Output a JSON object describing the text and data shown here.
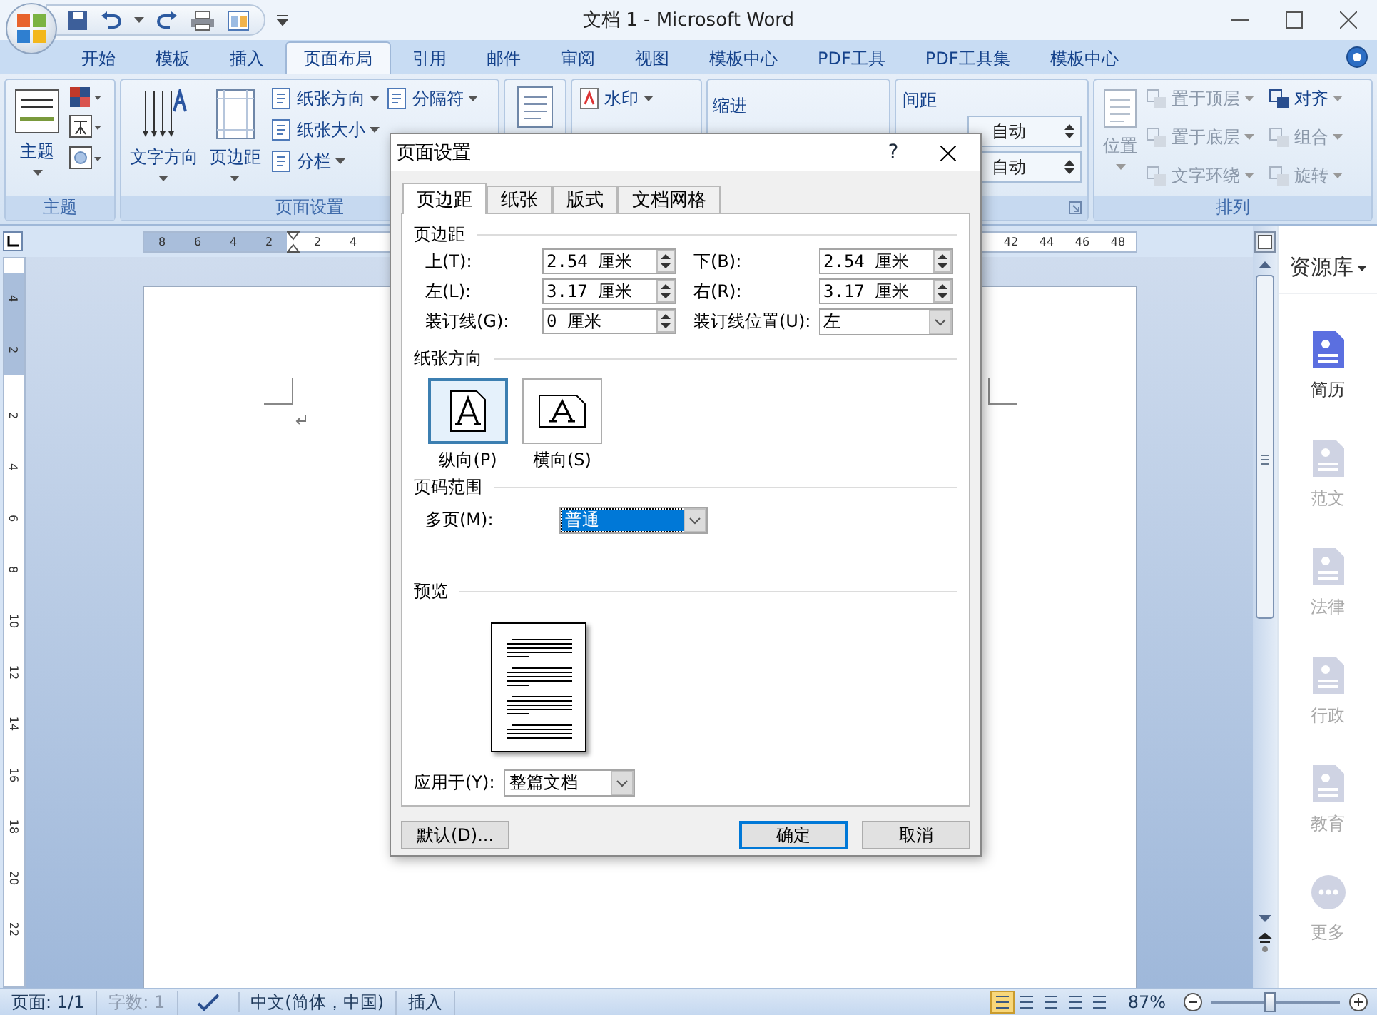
{
  "window": {
    "title": "文档 1 - Microsoft Word"
  },
  "tabs": [
    {
      "label": "开始",
      "selected": false
    },
    {
      "label": "模板",
      "selected": false
    },
    {
      "label": "插入",
      "selected": false
    },
    {
      "label": "页面布局",
      "selected": true
    },
    {
      "label": "引用",
      "selected": false
    },
    {
      "label": "邮件",
      "selected": false
    },
    {
      "label": "审阅",
      "selected": false
    },
    {
      "label": "视图",
      "selected": false
    },
    {
      "label": "模板中心",
      "selected": false
    },
    {
      "label": "PDF工具",
      "selected": false
    },
    {
      "label": "PDF工具集",
      "selected": false
    },
    {
      "label": "模板中心",
      "selected": false
    }
  ],
  "ribbon": {
    "theme": {
      "label": "主题",
      "button": "主题"
    },
    "page_setup": {
      "label": "页面设置",
      "large_buttons": [
        "文字方向",
        "页边距"
      ],
      "small_buttons": [
        "纸张方向",
        "纸张大小",
        "分栏"
      ],
      "breaks": "分隔符"
    },
    "background": {
      "watermark": "水印"
    },
    "paragraph": {
      "indent": "缩进",
      "spacing": "间距",
      "spacing_values": [
        "自动",
        "自动"
      ]
    },
    "arrange": {
      "label": "排列",
      "position": {
        "label": "位置",
        "disabled": true
      },
      "items": [
        {
          "label": "置于顶层",
          "disabled": true
        },
        {
          "label": "对齐",
          "disabled": false
        },
        {
          "label": "置于底层",
          "disabled": true
        },
        {
          "label": "组合",
          "disabled": true
        },
        {
          "label": "文字环绕",
          "disabled": true
        },
        {
          "label": "旋转",
          "disabled": true
        }
      ]
    }
  },
  "ruler": {
    "left_numbers": [
      "8",
      "6",
      "4",
      "2"
    ],
    "right_numbers": [
      "2",
      "4"
    ],
    "far_numbers": [
      "42",
      "44",
      "46",
      "48"
    ]
  },
  "vertical_ruler": {
    "top_numbers": [
      "4",
      "2"
    ],
    "numbers": [
      "2",
      "4",
      "6",
      "8",
      "10",
      "12",
      "14",
      "16",
      "18",
      "20",
      "22"
    ]
  },
  "dialog": {
    "title": "页面设置",
    "help": "?",
    "tabs": [
      {
        "label": "页边距",
        "selected": true
      },
      {
        "label": "纸张",
        "selected": false
      },
      {
        "label": "版式",
        "selected": false
      },
      {
        "label": "文档网格",
        "selected": false
      }
    ],
    "margins": {
      "title": "页边距",
      "fields": [
        {
          "label": "上(T):",
          "value": "2.54 厘米",
          "kind": "spin"
        },
        {
          "label": "下(B):",
          "value": "2.54 厘米",
          "kind": "spin"
        },
        {
          "label": "左(L):",
          "value": "3.17 厘米",
          "kind": "spin"
        },
        {
          "label": "右(R):",
          "value": "3.17 厘米",
          "kind": "spin"
        },
        {
          "label": "装订线(G):",
          "value": "0 厘米",
          "kind": "spin"
        },
        {
          "label": "装订线位置(U):",
          "value": "左",
          "kind": "select"
        }
      ]
    },
    "orientation": {
      "title": "纸张方向",
      "options": [
        {
          "label": "纵向(P)",
          "kind": "portrait",
          "selected": true
        },
        {
          "label": "横向(S)",
          "kind": "landscape",
          "selected": false
        }
      ]
    },
    "pages": {
      "title": "页码范围",
      "label": "多页(M):",
      "value": "普通"
    },
    "preview": {
      "title": "预览"
    },
    "apply": {
      "label": "应用于(Y):",
      "value": "整篇文档"
    },
    "buttons": [
      {
        "label": "默认(D)...",
        "default": false
      },
      {
        "label": "确定",
        "default": true
      },
      {
        "label": "取消",
        "default": false
      }
    ]
  },
  "sidebar": {
    "title": "资源库",
    "items": [
      {
        "label": "简历",
        "selected": true
      },
      {
        "label": "范文",
        "selected": false
      },
      {
        "label": "法律",
        "selected": false
      },
      {
        "label": "行政",
        "selected": false
      },
      {
        "label": "教育",
        "selected": false
      },
      {
        "label": "更多",
        "selected": false
      }
    ]
  },
  "status_bar": {
    "items": [
      {
        "text": "页面: 1/1",
        "disabled": false
      },
      {
        "text": "字数: 1",
        "disabled": true
      }
    ],
    "language": "中文(简体，中国)",
    "mode": "插入",
    "zoom": "87%",
    "zoom_slider": {
      "level": 0.46
    }
  }
}
